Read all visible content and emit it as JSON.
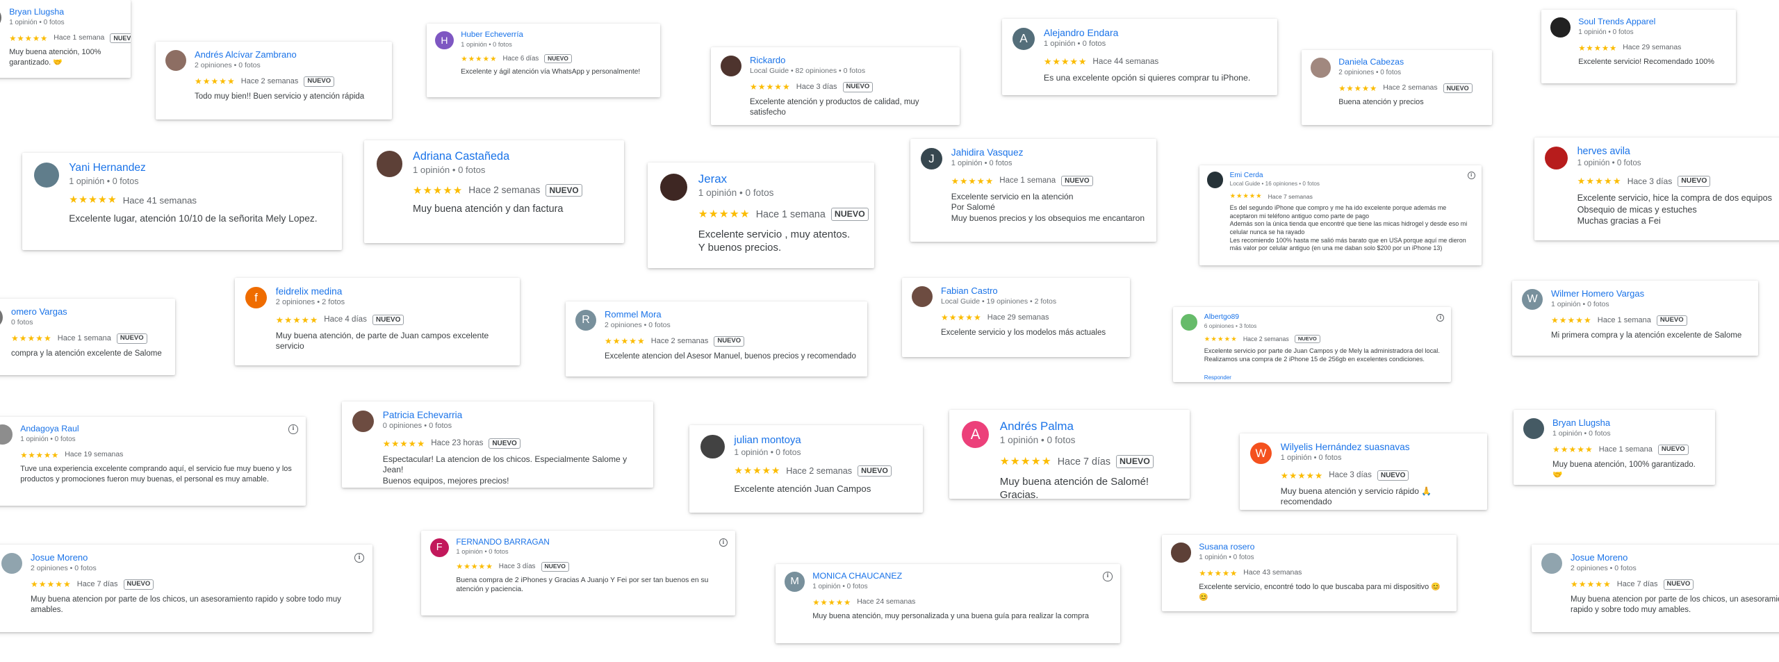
{
  "reviews": [
    {
      "name": "Bryan Llugsha",
      "meta": "1 opinión • 0 fotos",
      "age": "Hace 1 semana",
      "badge": "NUEVO",
      "text": "Muy buena atención, 100% garantizado. 🤝"
    },
    {
      "name": "Andrés Alcívar Zambrano",
      "meta": "2 opiniones • 0 fotos",
      "age": "Hace 2 semanas",
      "badge": "NUEVO",
      "text": "Todo muy bien!! Buen servicio y atención rápida"
    },
    {
      "name": "Huber Echeverría",
      "initial": "H",
      "meta": "1 opinión • 0 fotos",
      "age": "Hace 6 días",
      "badge": "NUEVO",
      "text": "Excelente y ágil atención vía WhatsApp y personalmente!"
    },
    {
      "name": "Rickardo",
      "meta": "Local Guide • 82 opiniones • 0 fotos",
      "age": "Hace 3 días",
      "badge": "NUEVO",
      "text": "Excelente atención y productos de calidad, muy satisfecho"
    },
    {
      "name": "Alejandro Endara",
      "initial": "A",
      "meta": "1 opinión • 0 fotos",
      "age": "Hace 44 semanas",
      "text": "Es una excelente opción si quieres comprar tu iPhone."
    },
    {
      "name": "Daniela Cabezas",
      "meta": "2 opiniones • 0 fotos",
      "age": "Hace 2 semanas",
      "badge": "NUEVO",
      "text": "Buena atención y precios"
    },
    {
      "name": "Soul Trends Apparel",
      "meta": "1 opinión • 0 fotos",
      "age": "Hace 29 semanas",
      "text": "Excelente servicio! Recomendado 100%"
    },
    {
      "name": "Yani Hernandez",
      "meta": "1 opinión • 0 fotos",
      "age": "Hace 41 semanas",
      "text": "Excelente lugar, atención 10/10 de la señorita Mely Lopez."
    },
    {
      "name": "Adriana Castañeda",
      "meta": "1 opinión • 0 fotos",
      "age": "Hace 2 semanas",
      "badge": "NUEVO",
      "text": "Muy buena atención y dan factura"
    },
    {
      "name": "Jerax",
      "meta": "1 opinión • 0 fotos",
      "age": "Hace 1 semana",
      "badge": "NUEVO",
      "text": "Excelente servicio , muy atentos.\nY buenos precios."
    },
    {
      "name": "Jahidira Vasquez",
      "initial": "J",
      "meta": "1 opinión • 0 fotos",
      "age": "Hace 1 semana",
      "badge": "NUEVO",
      "text": "Excelente servicio en la atención\nPor Salomé\nMuy buenos precios y los obsequios me encantaron"
    },
    {
      "name": "Emi Cerda",
      "meta": "Local Guide • 16 opiniones • 0 fotos",
      "age": "Hace 7 semanas",
      "text": "Es del segundo iPhone que compro y me ha ido excelente porque además me aceptaron mi teléfono antiguo como parte de pago\nAdemás son la única tienda que encontré que tiene las micas hidrogel y desde eso mi celular nunca se ha rayado\nLes recomiendo 100% hasta me salió más barato que en USA porque aquí me dieron más valor por celular antiguo (en una me daban solo $200 por un iPhone 13)"
    },
    {
      "name": "herves avila",
      "meta": "1 opinión • 0 fotos",
      "age": "Hace 3 días",
      "badge": "NUEVO",
      "text": "Excelente servicio, hice la compra de dos equipos\nObsequio de micas y estuches\nMuchas gracias a Fei"
    },
    {
      "name": "omero Vargas",
      "meta": "0 fotos",
      "age": "Hace 1 semana",
      "badge": "NUEVO",
      "text": "compra y la atención excelente de Salome"
    },
    {
      "name": "feidrelix medina",
      "initial": "f",
      "meta": "2 opiniones • 2 fotos",
      "age": "Hace 4 días",
      "badge": "NUEVO",
      "text": "Muy buena atención, de parte de Juan campos excelente servicio"
    },
    {
      "name": "Rommel Mora",
      "initial": "R",
      "meta": "2 opiniones • 0 fotos",
      "age": "Hace 2 semanas",
      "badge": "NUEVO",
      "text": "Excelente atencion del Asesor Manuel, buenos precios y recomendado"
    },
    {
      "name": "Fabian Castro",
      "meta": "Local Guide • 19 opiniones • 2 fotos",
      "age": "Hace 29 semanas",
      "text": "Excelente servicio y los modelos más actuales"
    },
    {
      "name": "Albertgo89",
      "meta": "6 opiniones • 3 fotos",
      "age": "Hace 2 semanas",
      "badge": "NUEVO",
      "text": "Excelente servicio por parte de Juan Campos y de Mely la administradora del local.\nRealizamos una compra de 2 iPhone 15 de 256gb en excelentes condiciones.",
      "link": "Responder"
    },
    {
      "name": "Wilmer Homero Vargas",
      "initial": "W",
      "meta": "1 opinión • 0 fotos",
      "age": "Hace 1 semana",
      "badge": "NUEVO",
      "text": "Mi primera compra y la atención excelente de Salome"
    },
    {
      "name": "Andagoya Raul",
      "meta": "1 opinión • 0 fotos",
      "age": "Hace 19 semanas",
      "text": "Tuve una experiencia excelente comprando aquí, el servicio fue muy bueno y los productos y promociones fueron muy buenas, el personal es muy amable."
    },
    {
      "name": "Patricia Echevarria",
      "meta": "0 opiniones • 0 fotos",
      "age": "Hace 23 horas",
      "badge": "NUEVO",
      "text": "Espectacular! La atencion de los chicos. Especialmente Salome y Jean!\nBuenos equipos, mejores precios!"
    },
    {
      "name": "julian montoya",
      "meta": "1 opinión • 0 fotos",
      "age": "Hace 2 semanas",
      "badge": "NUEVO",
      "text": "Excelente atención Juan Campos"
    },
    {
      "name": "Andrés Palma",
      "initial": "A",
      "meta": "1 opinión • 0 fotos",
      "age": "Hace 7 días",
      "badge": "NUEVO",
      "text": "Muy buena atención de Salomé! Gracias."
    },
    {
      "name": "Wilyelis Hernández suasnavas",
      "initial": "W",
      "meta": "1 opinión • 0 fotos",
      "age": "Hace 3 días",
      "badge": "NUEVO",
      "text": "Muy buena atención y servicio rápido 🙏 recomendado"
    },
    {
      "name": "Bryan Llugsha",
      "meta": "1 opinión • 0 fotos",
      "age": "Hace 1 semana",
      "badge": "NUEVO",
      "text": "Muy buena atención, 100% garantizado. 🤝"
    },
    {
      "name": "Josue Moreno",
      "meta": "2 opiniones • 0 fotos",
      "age": "Hace 7 días",
      "badge": "NUEVO",
      "text": "Muy buena atencion por parte de los chicos, un asesoramiento rapido y sobre todo muy amables."
    },
    {
      "name": "FERNANDO BARRAGAN",
      "initial": "F",
      "meta": "1 opinión • 0 fotos",
      "age": "Hace 3 días",
      "badge": "NUEVO",
      "text": "Buena compra de 2 iPhones y Gracias A Juanjo Y Fei por ser tan buenos en su atención y paciencia."
    },
    {
      "name": "MONICA CHAUCANEZ",
      "initial": "M",
      "meta": "1 opinión • 0 fotos",
      "age": "Hace 24 semanas",
      "text": "Muy buena atención, muy personalizada y una buena guía para realizar la compra"
    },
    {
      "name": "Susana rosero",
      "meta": "1 opinión • 0 fotos",
      "age": "Hace 43 semanas",
      "text": "Excelente servicio, encontré todo lo que buscaba para mi dispositivo 😊😊"
    },
    {
      "name": "Josue Moreno",
      "meta": "2 opiniones • 0 fotos",
      "age": "Hace 7 días",
      "badge": "NUEVO",
      "text": "Muy buena atencion por parte de los chicos, un asesoramiento rapido y sobre todo muy amables."
    }
  ],
  "stars": "★★★★★",
  "colors": {
    "link": "#1a73e8",
    "star": "#fbbc04",
    "text": "#3c4043",
    "meta": "#70757a"
  }
}
